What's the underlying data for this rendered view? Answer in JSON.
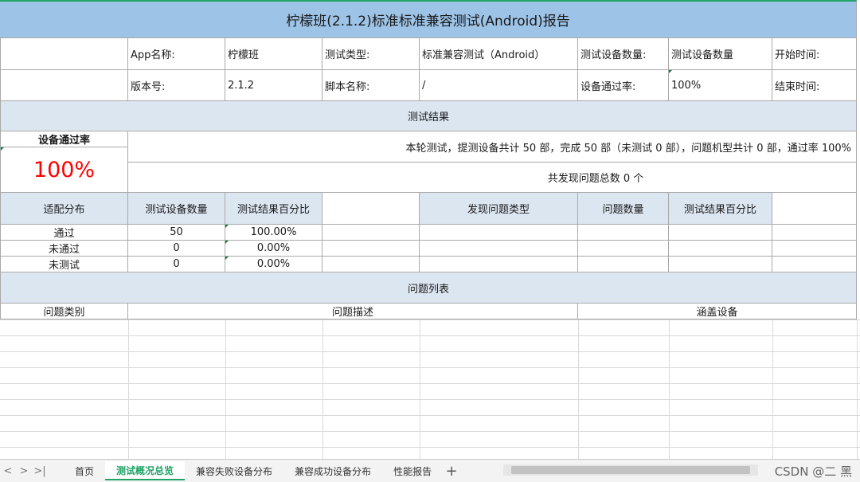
{
  "title": "柠檬班(2.1.2)标准标准兼容测试(Android)报告",
  "info": {
    "app_name_label": "App名称:",
    "app_name_value": "柠檬班",
    "test_type_label": "测试类型:",
    "test_type_value": "标准兼容测试（Android）",
    "device_count_label": "测试设备数量:",
    "device_count_value": "测试设备数量",
    "start_time_label": "开始时间:",
    "version_label": "版本号:",
    "version_value": "2.1.2",
    "script_label": "脚本名称:",
    "script_value": "/",
    "pass_rate_label": "设备通过率:",
    "pass_rate_value": "100%",
    "end_time_label": "结束时间:"
  },
  "result": {
    "section_title": "测试结果",
    "pass_rate_title": "设备通过率",
    "pass_rate_big": "100%",
    "summary": "本轮测试，提测设备共计 50 部，完成 50 部（未测试 0 部），问题机型共计 0 部，通过率 100%",
    "issues_total": "共发现问题总数 0 个"
  },
  "dist": {
    "headers": [
      "适配分布",
      "测试设备数量",
      "测试结果百分比",
      "发现问题类型",
      "问题数量",
      "测试结果百分比"
    ],
    "rows": [
      {
        "label": "通过",
        "count": "50",
        "pct": "100.00%"
      },
      {
        "label": "未通过",
        "count": "0",
        "pct": "0.00%"
      },
      {
        "label": "未测试",
        "count": "0",
        "pct": "0.00%"
      }
    ]
  },
  "issues": {
    "section_title": "问题列表",
    "headers": [
      "问题类别",
      "问题描述",
      "涵盖设备"
    ]
  },
  "tabs": [
    "首页",
    "测试概况总览",
    "兼容失败设备分布",
    "兼容成功设备分布",
    "性能报告"
  ],
  "active_tab": "测试概况总览",
  "nav": {
    "prev": "<",
    "next": ">",
    "last": ">|",
    "add": "+"
  },
  "watermark": "CSDN @二 黑",
  "colors": {
    "title_bg": "#9dc3e6",
    "section_bg": "#dce6f1",
    "accent_green": "#21a366",
    "big_red": "#ff0000"
  }
}
